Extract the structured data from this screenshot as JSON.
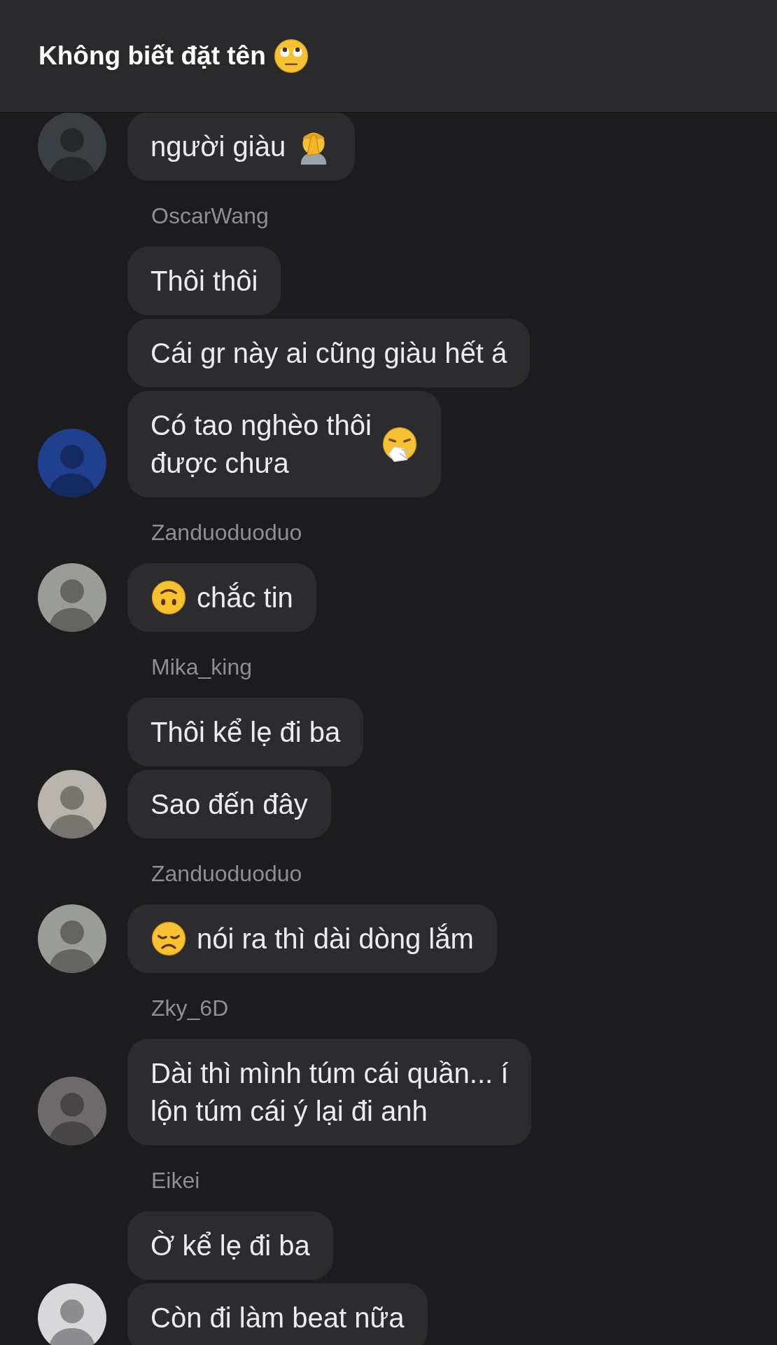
{
  "header": {
    "title": "Không biết đặt tên",
    "kind": "rollingeyes"
  },
  "groups": [
    {
      "avatar": {
        "color": "#3a3f44"
      },
      "messages": [
        {
          "text": "người giàu",
          "kind": "facepalm"
        }
      ]
    },
    {
      "sender": "OscarWang",
      "avatar": {
        "color": "#1f3f8f"
      },
      "messages": [
        {
          "text": "Thôi thôi",
          "kind": "plain"
        },
        {
          "text": "Cái gr này ai cũng giàu hết á",
          "kind": "plain"
        },
        {
          "text": "Có tao nghèo thôi\nđược chưa",
          "kind": "sneezing"
        }
      ]
    },
    {
      "sender": "Zanduoduoduo",
      "avatar": {
        "color": "#9a9c98"
      },
      "messages": [
        {
          "text": "chắc tin",
          "kind": "upsidedown"
        }
      ]
    },
    {
      "sender": "Mika_king",
      "avatar": {
        "color": "#b8b4ac"
      },
      "messages": [
        {
          "text": "Thôi kể lẹ đi ba",
          "kind": "plain"
        },
        {
          "text": "Sao đến đây",
          "kind": "plain"
        }
      ]
    },
    {
      "sender": "Zanduoduoduo",
      "avatar": {
        "color": "#9a9c98"
      },
      "messages": [
        {
          "text": "nói ra thì dài dòng lắm",
          "kind": "disappointed"
        }
      ]
    },
    {
      "sender": "Zky_6D",
      "avatar": {
        "color": "#6e6a6c"
      },
      "messages": [
        {
          "text": "Dài thì mình túm cái quần... í\nlộn túm cái ý lại đi anh",
          "kind": "plain"
        }
      ]
    },
    {
      "sender": "Eikei",
      "avatar": {
        "color": "#d8d8da"
      },
      "messages": [
        {
          "text": "Ờ kể lẹ đi ba",
          "kind": "plain"
        },
        {
          "text": "Còn đi làm beat nữa",
          "kind": "plain"
        }
      ]
    }
  ]
}
